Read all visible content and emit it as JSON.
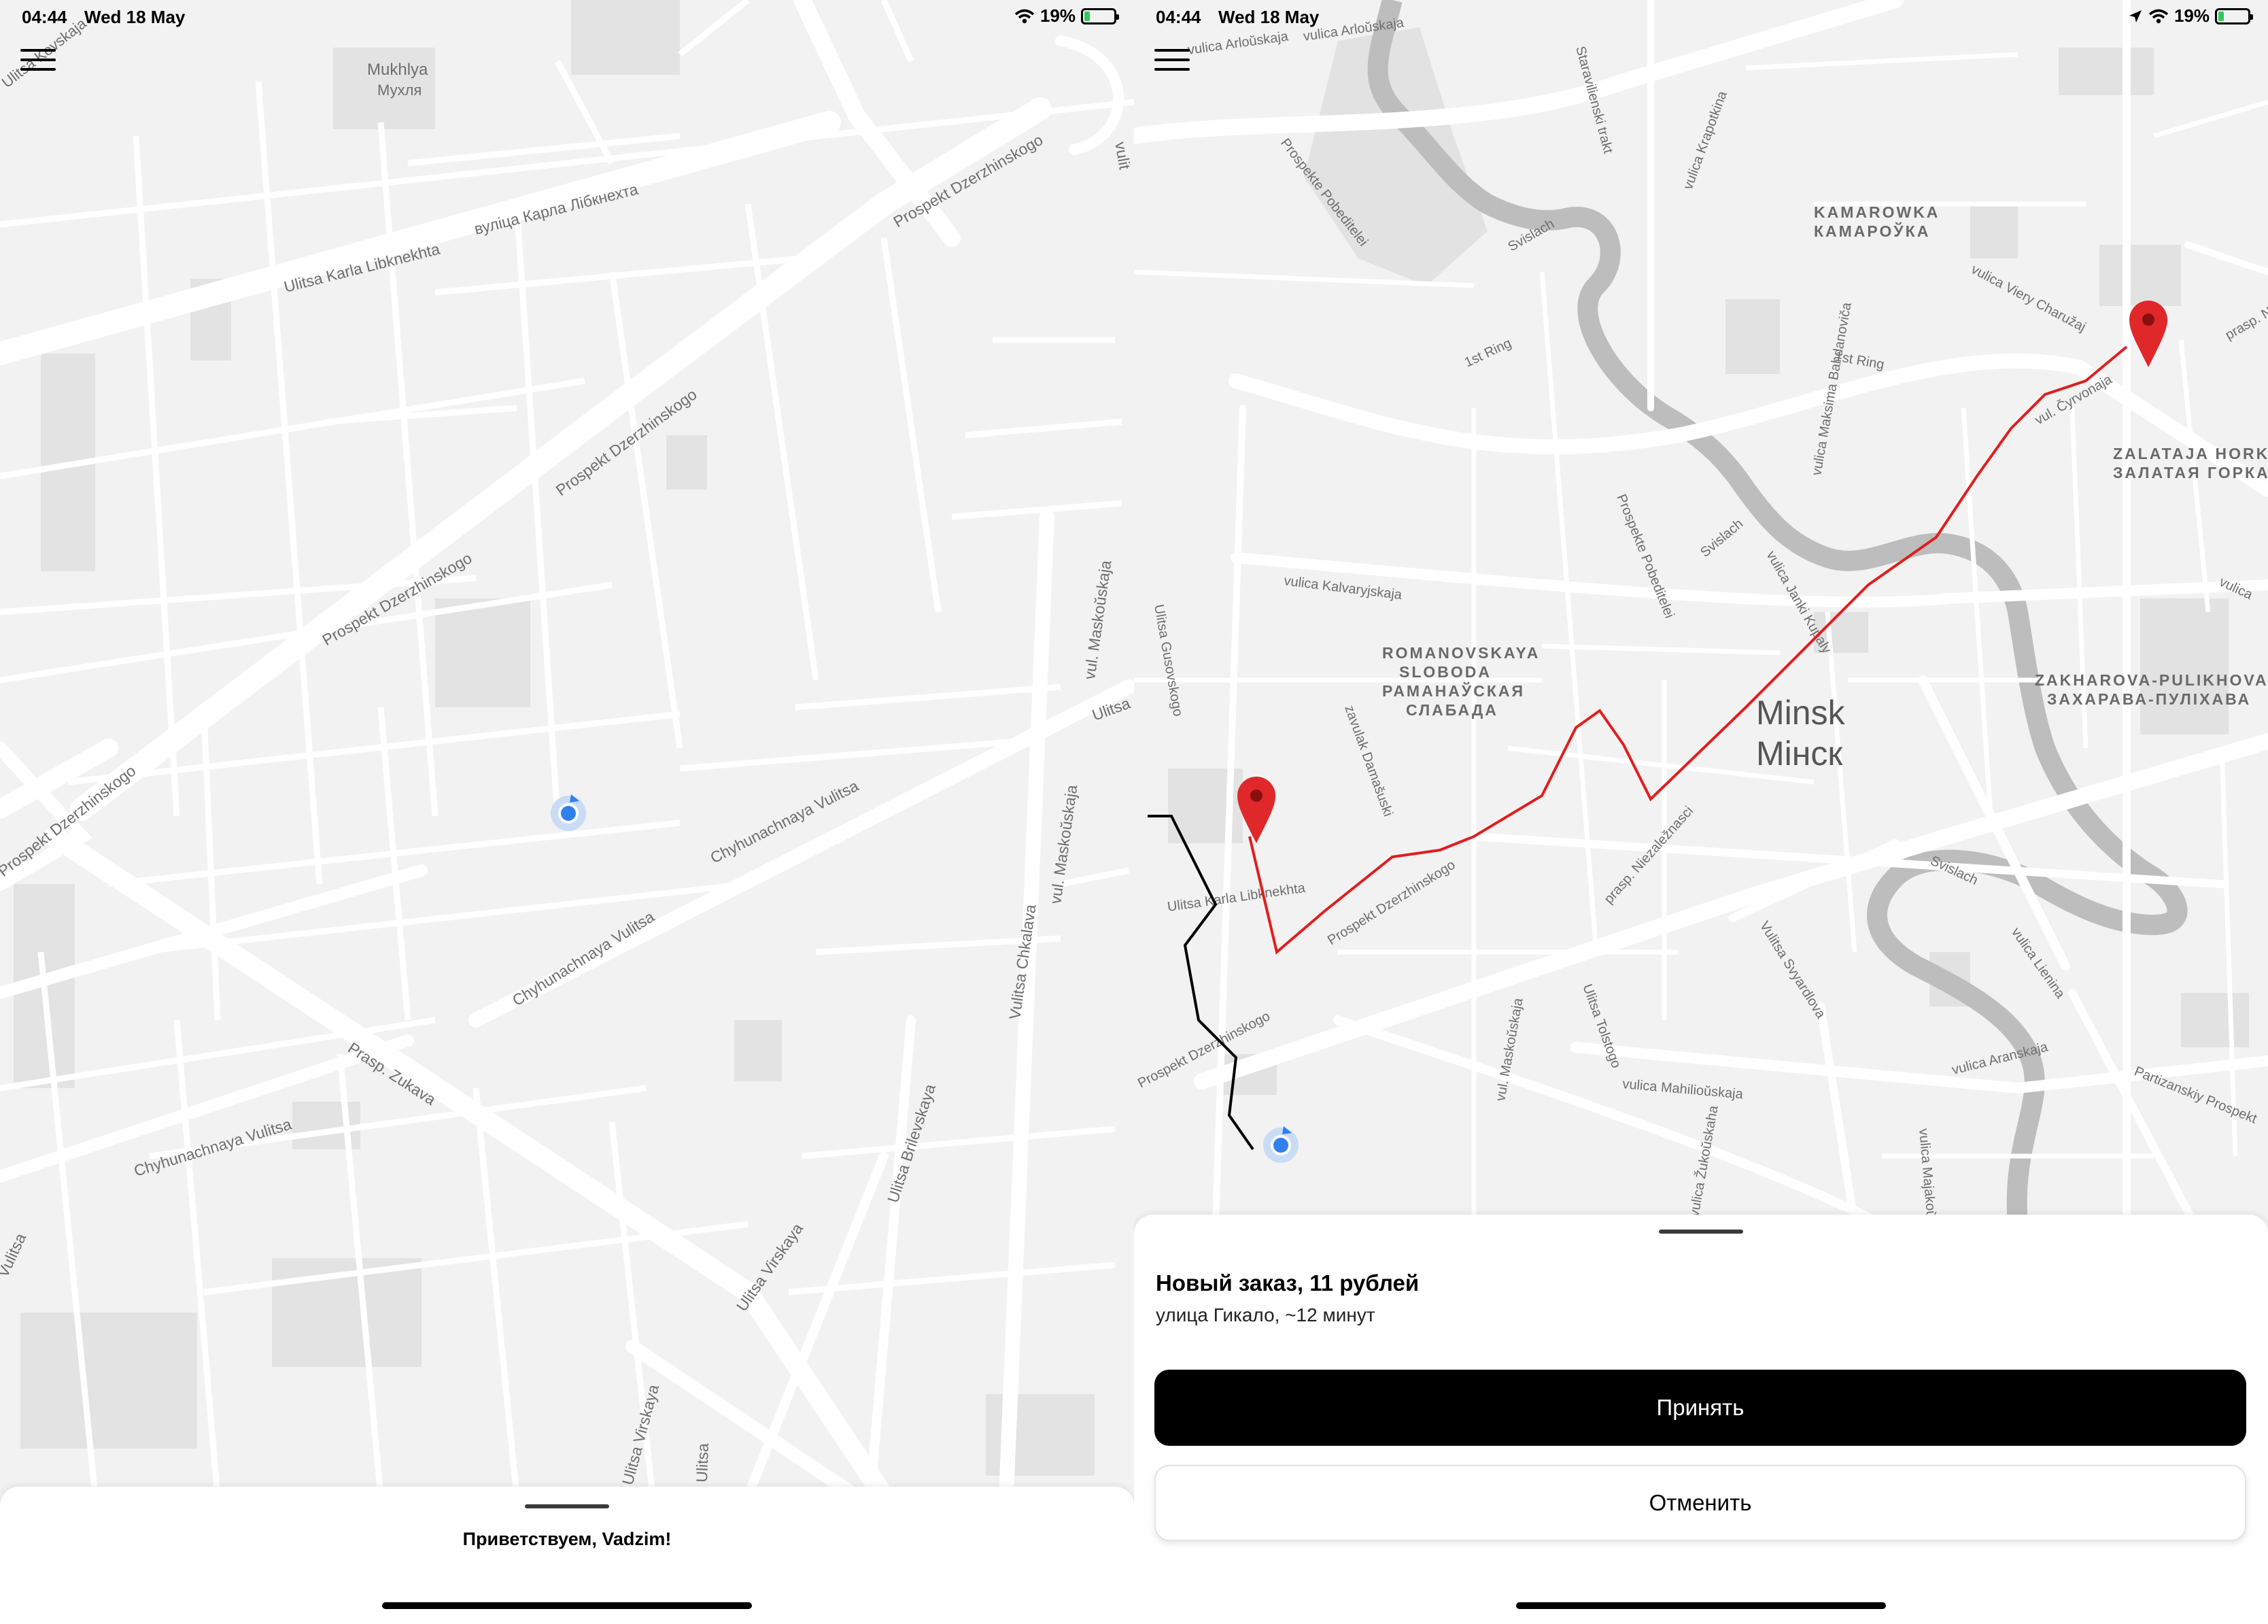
{
  "status_bar": {
    "time": "04:44",
    "date": "Wed 18 May",
    "battery_percent": "19%",
    "battery_level": 0.19,
    "accent": "#34c759"
  },
  "left_screen": {
    "map_labels": {
      "mukhlya_lat": "Mukhlya",
      "mukhlya_cyr": "Мухля",
      "karla_cyr": "вуліца Карла Лібкнехта",
      "karla_lat": "Ulitsa Karla Libknekhta",
      "dzerzh_1": "Prospekt Dzerzhinskogo",
      "dzerzh_2": "Prospekt Dzerzhinskogo",
      "dzerzh_3": "Prospekt Dzerzhinskogo",
      "dzerzh_4": "Prospekt Dzerzhinskogo",
      "dzerzh_left": "Prospekt Dzerzhinskogo",
      "chyh_1": "Chyhunachnaya Vulitsa",
      "chyh_2": "Chyhunachnaya Vulitsa",
      "chyh_3": "Chyhunachnaya Vulitsa",
      "zukava": "Prasp. Zukava",
      "maskouskaja_1": "vul. Maskoŭskaja",
      "maskouskaja_2": "vul. Maskoŭskaja",
      "chkalava": "Vulitsa Chkalava",
      "brilevskaya": "Ulitsa Brilevskaya",
      "virskaya_1": "Ulitsa Virskaya",
      "virskaya_2": "Ulitsa Virskaya",
      "vulitsa_left": "Vulitsa",
      "ulitsa_right": "Ulitsa",
      "ulitsa_bottom": "Ulitsa",
      "vulitsa_top": "vulit",
      "kovski_top": "Ulitsa Kovskaja"
    },
    "greeting": "Приветствуем, Vadzim!"
  },
  "right_screen": {
    "map_labels": {
      "arloskaja_1": "vulica Arloŭskaja",
      "arloskaja_2": "vulica Arloŭskaja",
      "staravilenski": "Staravilienski trakt",
      "pobeditelei_1": "Prospekte Pobeditelei",
      "pobeditelei_2": "Prospekte Pobeditelei",
      "svislach_1": "Svislach",
      "svislach_2": "Svislach",
      "svislach_3": "Svislach",
      "krapotkina": "vulica Krapotkina",
      "kamarowka": "KAMAROWKA",
      "kamarowka_cyr": "КАМАРОЎКА",
      "viery": "vulica Viery Charužaj",
      "ring_1": "1st Ring",
      "ring_2": "1st Ring",
      "bahdanovica": "vulica Maksima Bahdanoviča",
      "cyrvonaja": "vul. Čyrvonaja",
      "niez_top": "prasp. Niez",
      "zalataja": "ZALATAJA HORKA",
      "zalataja_cyr": "ЗАЛАТАЯ ГОРКА",
      "kalvaryjskaja": "vulica Kalvaryjskaja",
      "janki_kupaly": "vulica Janki Kupaly",
      "romanovskaya_1": "ROMANOVSKAYA",
      "romanovskaya_2": "SLOBODA",
      "romanovskaya_3": "РАМАНАЎСКАЯ",
      "romanovskaya_4": "СЛАБАДА",
      "zakharova_1": "ZAKHAROVA-PULIKHOVA",
      "zakharova_2": "ЗАХАРАВА-ПУЛІХАВА",
      "minsk_lat": "Minsk",
      "minsk_cyr": "Мінск",
      "gusovskogo": "Ulitsa Gusovskogo",
      "damasuski": "zavulak Damašuski",
      "karla": "Ulitsa Karla Libknekhta",
      "dzerzh_1": "Prospekt Dzerzhinskogo",
      "dzerzh_2": "Prospekt Dzerzhinskogo",
      "niezaleznasci": "prasp. Niezaležnasci",
      "svardlova": "Vulitsa Svyardlova",
      "lienina": "vulica Lienina",
      "tolstogo": "Ulitsa Tolstogo",
      "maskouskaja": "vul. Maskoŭskaja",
      "mahilioskaja": "vulica Mahilioŭskaja",
      "aranskaja": "vulica Aranskaja",
      "partizanskiy": "Partizanskiy Prospekt",
      "zukouskaha": "vulica Žukoŭskaha",
      "majakouskaha": "vulica Majakoŭskaha",
      "vulica_right": "vulica"
    },
    "order": {
      "title": "Новый заказ, 11 рублей",
      "subtitle": "улица Гикало, ~12 минут"
    },
    "accept_label": "Принять",
    "cancel_label": "Отменить",
    "route_colors": {
      "driver_route": "#000000",
      "order_route": "#e01e1e",
      "pin": "#e0282a"
    }
  }
}
